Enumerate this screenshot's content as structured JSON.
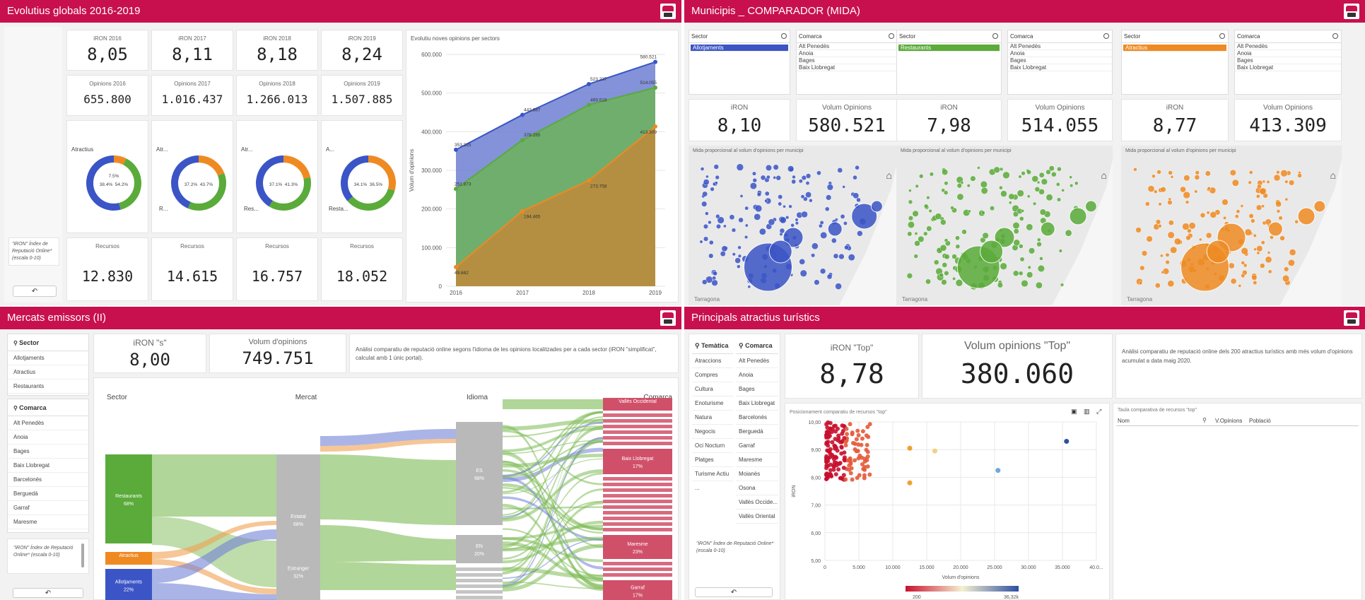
{
  "p1": {
    "title": "Evolutius globals 2016-2019",
    "kpi_iron": [
      {
        "label": "iRON 2016",
        "value": "8,05"
      },
      {
        "label": "iRON 2017",
        "value": "8,11"
      },
      {
        "label": "iRON 2018",
        "value": "8,18"
      },
      {
        "label": "iRON 2019",
        "value": "8,24"
      }
    ],
    "kpi_opinions": [
      {
        "label": "Opinions 2016",
        "value": "655.800"
      },
      {
        "label": "Opinions 2017",
        "value": "1.016.437"
      },
      {
        "label": "Opinions 2018",
        "value": "1.266.013"
      },
      {
        "label": "Opinions 2019",
        "value": "1.507.885"
      }
    ],
    "donuts": [
      {
        "label_a": "Atractius",
        "label_b": "",
        "p1": "7.5%",
        "p2": "38.4%",
        "p3": "54.2%"
      },
      {
        "label_a": "Atr...",
        "label_b": "R...",
        "p1": "",
        "p2": "37.2%",
        "p3": "43.7%"
      },
      {
        "label_a": "Atr...",
        "label_b": "Res...",
        "p1": "",
        "p2": "37.1%",
        "p3": "41.3%"
      },
      {
        "label_a": "A...",
        "label_b": "Resta...",
        "p1": "",
        "p2": "34.1%",
        "p3": "36.5%"
      }
    ],
    "kpi_recursos": [
      {
        "label": "Recursos",
        "value": "12.830"
      },
      {
        "label": "Recursos",
        "value": "14.615"
      },
      {
        "label": "Recursos",
        "value": "16.757"
      },
      {
        "label": "Recursos",
        "value": "18.052"
      }
    ],
    "note": "\"iRON\" Índex de Reputació Online* (escala 0-10)",
    "back_label": "↶"
  },
  "chart_data": {
    "type": "area",
    "title": "Evolutiu noves opinions per sectors",
    "xlabel": "",
    "ylabel": "Volum d'opinions",
    "x": [
      "2016",
      "2017",
      "2018",
      "2019"
    ],
    "ylim": [
      0,
      600000
    ],
    "yticks": [
      "0",
      "100.000",
      "200.000",
      "300.000",
      "400.000",
      "500.000",
      "600.000"
    ],
    "series": [
      {
        "values": [
          353225,
          443687,
          523237,
          580521
        ],
        "color": "#3b55c6",
        "labels": [
          "353.225",
          "443.687",
          "523.237",
          "580.521"
        ]
      },
      {
        "values": [
          251873,
          378285,
          469518,
          514055
        ],
        "color": "#5aab3a",
        "labels": [
          "251.873",
          "378.285",
          "469.518",
          "514.055"
        ]
      },
      {
        "values": [
          49682,
          194465,
          273758,
          413309
        ],
        "color": "#ef8a22",
        "labels": [
          "49.682",
          "194.465",
          "273.758",
          "413.309"
        ]
      }
    ]
  },
  "p2": {
    "title": "Municipis _ COMPARADOR (MIDA)",
    "groups": [
      {
        "sector_header": "Sector",
        "sector_sel": "Allotjaments",
        "comarca_header": "Comarca",
        "comarques": [
          "Alt Penedès",
          "Anoia",
          "Bages",
          "Baix Llobregat"
        ],
        "iron_label": "iRON",
        "iron": "8,10",
        "vol_label": "Volum Opinions",
        "vol": "580.521",
        "map_title": "Mida proporcional al volum d'opinions per municipi",
        "color": "#3b55c6"
      },
      {
        "sector_header": "Sector",
        "sector_sel": "Restaurants",
        "comarca_header": "Comarca",
        "comarques": [
          "Alt Penedès",
          "Anoia",
          "Bages",
          "Baix Llobregat"
        ],
        "iron_label": "iRON",
        "iron": "7,98",
        "vol_label": "Volum Opinions",
        "vol": "514.055",
        "map_title": "Mida proporcional al volum d'opinions per municipi",
        "color": "#5aab3a"
      },
      {
        "sector_header": "Sector",
        "sector_sel": "Atractius",
        "comarca_header": "Comarca",
        "comarques": [
          "Alt Penedès",
          "Anoia",
          "Bages",
          "Baix Llobregat"
        ],
        "iron_label": "iRON",
        "iron": "8,77",
        "vol_label": "Volum Opinions",
        "vol": "413.309",
        "map_title": "Mida proporcional al volum d'opinions per municipi",
        "color": "#ef8a22"
      }
    ],
    "map_city": "Tarragona"
  },
  "p3": {
    "title": "Mercats emissors (II)",
    "sector_header": "Sector",
    "sectors": [
      "Allotjaments",
      "Atractius",
      "Restaurants"
    ],
    "comarca_header": "Comarca",
    "comarques": [
      "Alt Penedès",
      "Anoia",
      "Bages",
      "Baix Llobregat",
      "Barcelonès",
      "Berguedà",
      "Garraf",
      "Maresme"
    ],
    "note": "\"iRON\" Índex de Reputació Online* (escala 0-10)",
    "back_label": "↶",
    "kpi_iron_label": "iRON \"s\"",
    "kpi_iron": "8,00",
    "kpi_vol_label": "Volum d'opinions",
    "kpi_vol": "749.751",
    "desc": "Anàlisi comparatiu de reputació online segons l'idioma de les opinions localitzades per a cada sector (iRON \"simplificat\", calculat amb 1 únic portal).",
    "cols": [
      "Sector",
      "Mercat",
      "Idioma",
      "Comarca"
    ],
    "nodes": {
      "restaurants": [
        "Restaurants",
        "68%"
      ],
      "atractius": "Atractius",
      "allotjaments": [
        "Allotjaments",
        "22%"
      ],
      "estatal": [
        "Estatal",
        "68%"
      ],
      "estranger": [
        "Estranger",
        "32%"
      ],
      "es": [
        "ES",
        "68%"
      ],
      "en": [
        "EN",
        "20%"
      ],
      "valles_occ": "Vallès Occidental",
      "baix_llob": [
        "Baix Llobregat",
        "17%"
      ],
      "maresme": [
        "Maresme",
        "23%"
      ],
      "garraf": [
        "Garraf",
        "17%"
      ]
    }
  },
  "p4": {
    "title": "Principals atractius turístics",
    "tematica_header": "Temàtica",
    "tematiques": [
      "Atraccions",
      "Compres",
      "Cultura",
      "Enoturisme",
      "Natura",
      "Negocis",
      "Oci Nocturn",
      "Platges",
      "Turisme Actiu ..."
    ],
    "comarca_header": "Comarca",
    "comarques": [
      "Alt Penedès",
      "Anoia",
      "Bages",
      "Baix Llobregat",
      "Barcelonès",
      "Berguedà",
      "Garraf",
      "Maresme",
      "Moianès",
      "Osona",
      "Vallès Occide...",
      "Vallès Oriental"
    ],
    "note": "\"iRON\" Índex de Reputació Online* (escala 0-10)",
    "back_label": "↶",
    "kpi_iron_label": "iRON \"Top\"",
    "kpi_iron": "8,78",
    "kpi_vol_label": "Volum opinions \"Top\"",
    "kpi_vol": "380.060",
    "desc": "Anàlisi comparatiu de reputació online dels 200 atractius turístics amb més volum d'opinions acumulat a data maig 2020.",
    "scatter_title": "Posicionament comparatiu de recursos \"top\"",
    "scatter_xlabel": "Volum d'opinions",
    "scatter_ylabel": "iRON",
    "scatter_xticks": [
      "0",
      "5.000",
      "10.000",
      "15.000",
      "20.000",
      "25.000",
      "30.000",
      "35.000",
      "40.0..."
    ],
    "scatter_yticks": [
      "5,00",
      "6,00",
      "7,00",
      "8,00",
      "9,00",
      "10,00"
    ],
    "legend_min": "200",
    "legend_max": "36,32k",
    "table_title": "Taula comparativa de recursos \"top\"",
    "table_cols": [
      "Nom",
      "V.Opinions",
      "Població"
    ]
  }
}
